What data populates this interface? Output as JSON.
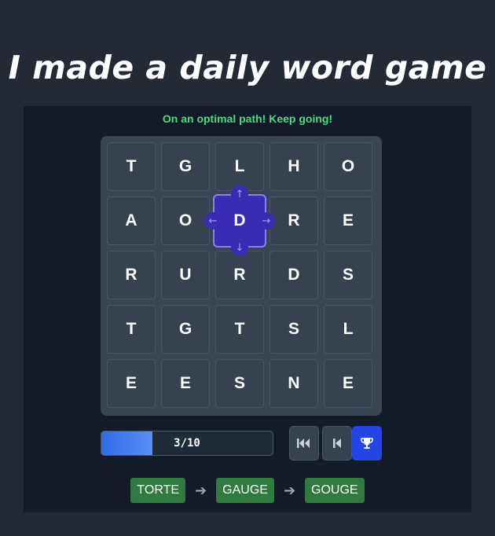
{
  "headline": "I made a daily word game",
  "status": "On an optimal path! Keep going!",
  "grid": [
    [
      "T",
      "G",
      "L",
      "H",
      "O"
    ],
    [
      "A",
      "O",
      "D",
      "R",
      "E"
    ],
    [
      "R",
      "U",
      "R",
      "D",
      "S"
    ],
    [
      "T",
      "G",
      "T",
      "S",
      "L"
    ],
    [
      "E",
      "E",
      "S",
      "N",
      "E"
    ]
  ],
  "selected": {
    "row": 1,
    "col": 2
  },
  "progress": {
    "label": "3/10",
    "fraction": 0.3
  },
  "controls": {
    "rewind": "rewind-to-start-icon",
    "back": "step-back-icon",
    "trophy": "trophy-icon"
  },
  "colors": {
    "status": "#4ade80",
    "selected_tile": "#3a2bb4",
    "word_chip": "#2f7a3e",
    "trophy_button": "#2546e6"
  },
  "word_chain": [
    "TORTE",
    "GAUGE",
    "GOUGE"
  ]
}
